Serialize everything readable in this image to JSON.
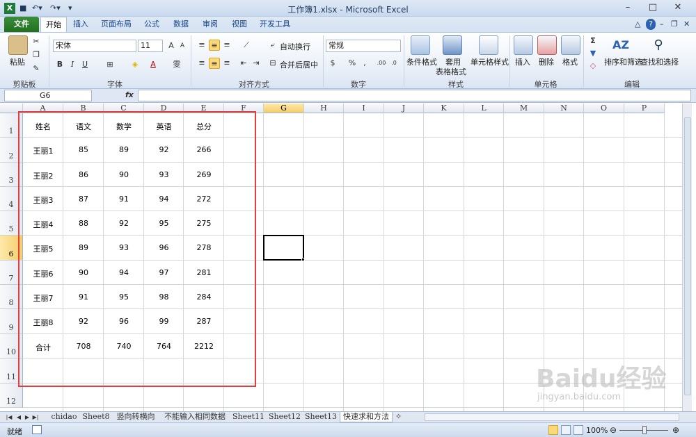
{
  "window": {
    "title": "工作簿1.xlsx - Microsoft Excel"
  },
  "ribbon": {
    "tabs": [
      "文件",
      "开始",
      "插入",
      "页面布局",
      "公式",
      "数据",
      "审阅",
      "视图",
      "开发工具"
    ],
    "active_tab": "开始",
    "clipboard": {
      "paste": "粘贴",
      "group": "剪贴板"
    },
    "font": {
      "name": "宋体",
      "size": "11",
      "group": "字体",
      "bold": "B",
      "italic": "I",
      "underline": "U"
    },
    "alignment": {
      "wrap": "自动换行",
      "merge": "合并后居中",
      "group": "对齐方式"
    },
    "number": {
      "format": "常规",
      "percent": "%",
      "group": "数字"
    },
    "styles": {
      "conditional": "条件格式",
      "table": "套用",
      "table2": "表格格式",
      "cell_styles": "单元格样式",
      "group": "样式"
    },
    "cells": {
      "insert": "插入",
      "delete": "删除",
      "format": "格式",
      "group": "单元格"
    },
    "editing": {
      "sort": "排序和筛选",
      "find": "查找和选择",
      "group": "编辑"
    }
  },
  "formula_bar": {
    "name_box": "G6",
    "fx": "fx",
    "value": ""
  },
  "columns": [
    "A",
    "B",
    "C",
    "D",
    "E",
    "F",
    "G",
    "H",
    "I",
    "J",
    "K",
    "L",
    "M",
    "N",
    "O",
    "P"
  ],
  "rows": [
    "1",
    "2",
    "3",
    "4",
    "5",
    "6",
    "7",
    "8",
    "9",
    "10",
    "11",
    "12"
  ],
  "selected_cell": {
    "column": "G",
    "row": "6"
  },
  "sheet": {
    "headers": [
      "姓名",
      "语文",
      "数学",
      "英语",
      "总分"
    ],
    "data": [
      [
        "王丽1",
        "85",
        "89",
        "92",
        "266"
      ],
      [
        "王丽2",
        "86",
        "90",
        "93",
        "269"
      ],
      [
        "王丽3",
        "87",
        "91",
        "94",
        "272"
      ],
      [
        "王丽4",
        "88",
        "92",
        "95",
        "275"
      ],
      [
        "王丽5",
        "89",
        "93",
        "96",
        "278"
      ],
      [
        "王丽6",
        "90",
        "94",
        "97",
        "281"
      ],
      [
        "王丽7",
        "91",
        "95",
        "98",
        "284"
      ],
      [
        "王丽8",
        "92",
        "96",
        "99",
        "287"
      ],
      [
        "合计",
        "708",
        "740",
        "764",
        "2212"
      ]
    ]
  },
  "sheet_tabs": [
    "chidao",
    "Sheet8",
    "竖向转横向",
    "不能输入相同数据",
    "Sheet11",
    "Sheet12",
    "Sheet13",
    "快速求和方法"
  ],
  "active_sheet": "快速求和方法",
  "status": {
    "ready": "就绪",
    "zoom": "100%"
  },
  "watermark": {
    "logo": "Baidu经验",
    "url": "jingyan.baidu.com"
  },
  "colors": {
    "accent": "#2e7d32",
    "highlight": "#e53c3c",
    "selection_header": "#f6cd6b"
  }
}
